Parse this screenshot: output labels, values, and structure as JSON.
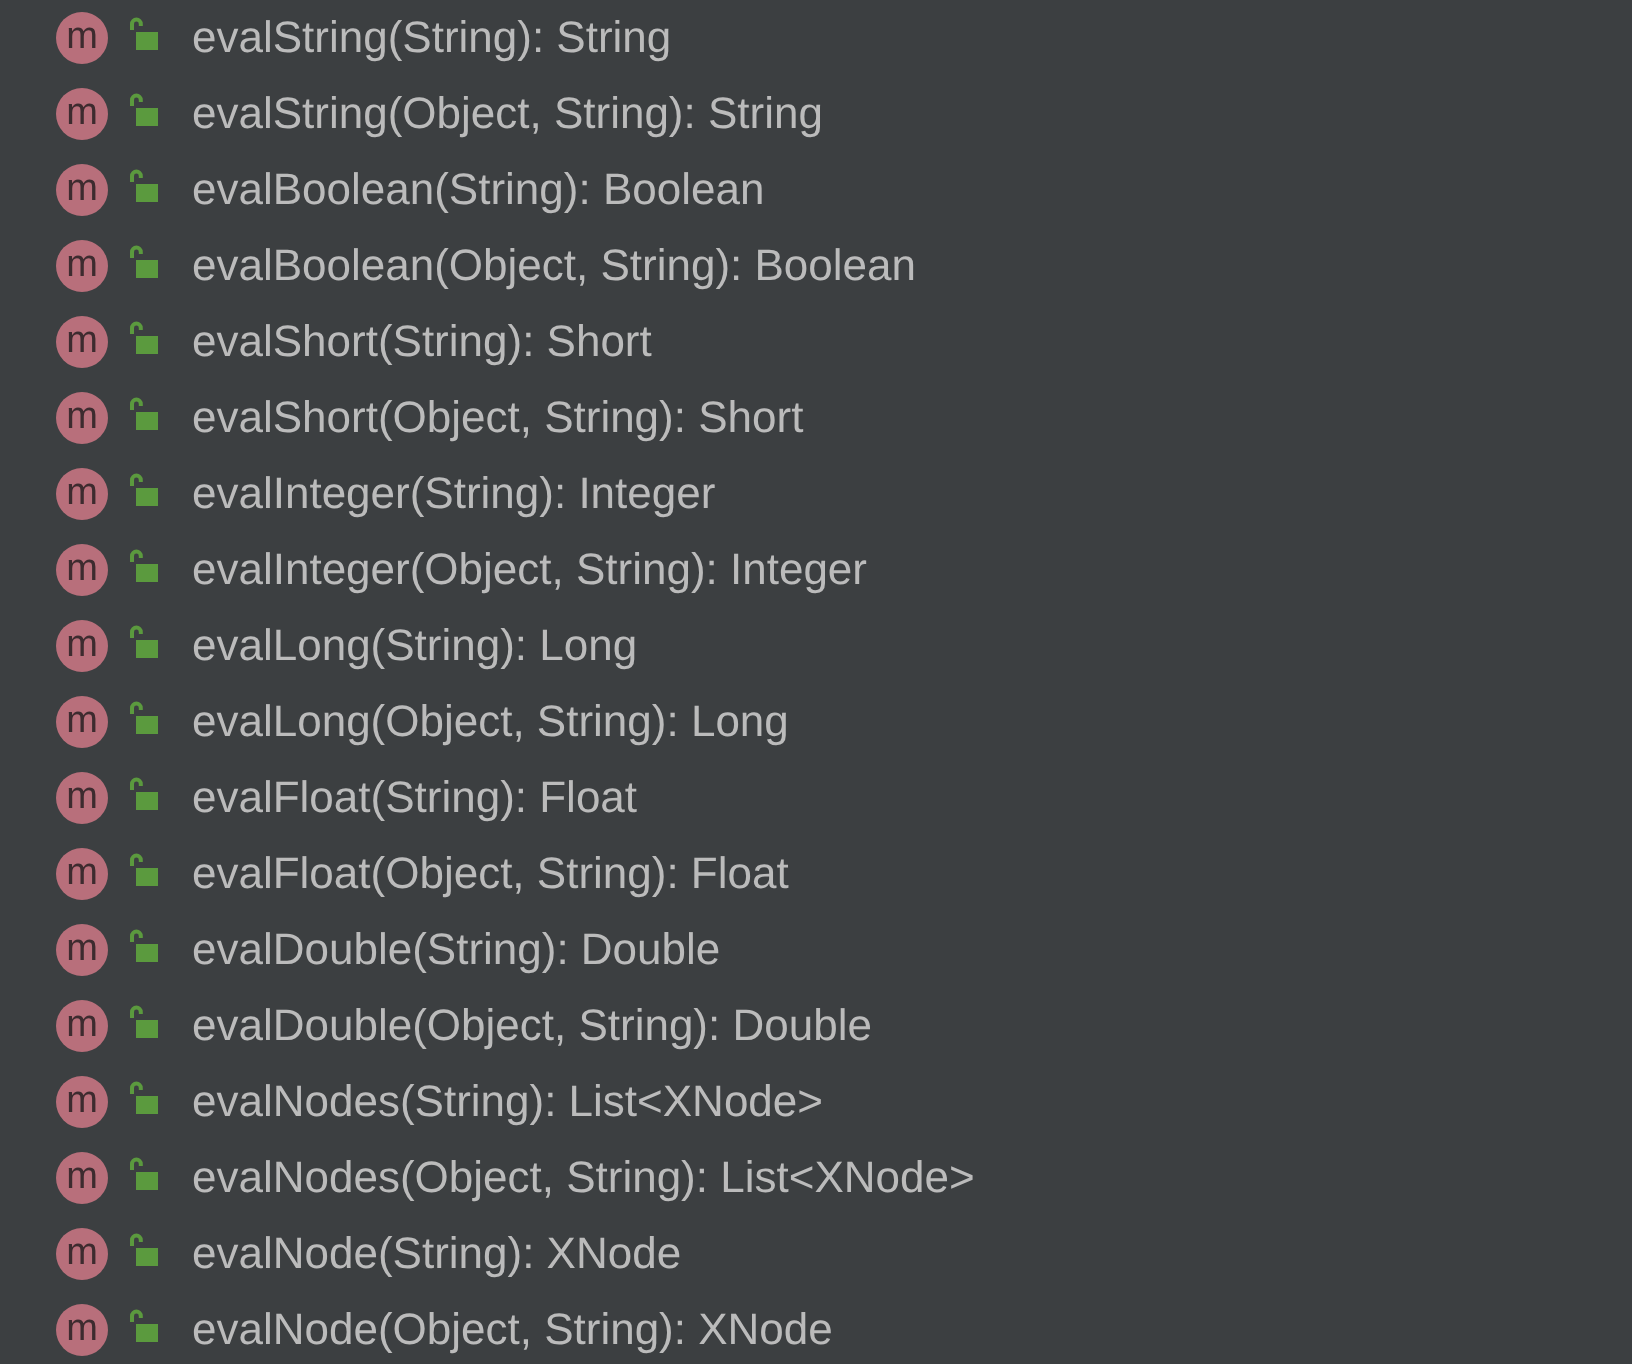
{
  "members": [
    {
      "icon_letter": "m",
      "signature": "evalString(String): String"
    },
    {
      "icon_letter": "m",
      "signature": "evalString(Object, String): String"
    },
    {
      "icon_letter": "m",
      "signature": "evalBoolean(String): Boolean"
    },
    {
      "icon_letter": "m",
      "signature": "evalBoolean(Object, String): Boolean"
    },
    {
      "icon_letter": "m",
      "signature": "evalShort(String): Short"
    },
    {
      "icon_letter": "m",
      "signature": "evalShort(Object, String): Short"
    },
    {
      "icon_letter": "m",
      "signature": "evalInteger(String): Integer"
    },
    {
      "icon_letter": "m",
      "signature": "evalInteger(Object, String): Integer"
    },
    {
      "icon_letter": "m",
      "signature": "evalLong(String): Long"
    },
    {
      "icon_letter": "m",
      "signature": "evalLong(Object, String): Long"
    },
    {
      "icon_letter": "m",
      "signature": "evalFloat(String): Float"
    },
    {
      "icon_letter": "m",
      "signature": "evalFloat(Object, String): Float"
    },
    {
      "icon_letter": "m",
      "signature": "evalDouble(String): Double"
    },
    {
      "icon_letter": "m",
      "signature": "evalDouble(Object, String): Double"
    },
    {
      "icon_letter": "m",
      "signature": "evalNodes(String): List<XNode>"
    },
    {
      "icon_letter": "m",
      "signature": "evalNodes(Object, String): List<XNode>"
    },
    {
      "icon_letter": "m",
      "signature": "evalNode(String): XNode"
    },
    {
      "icon_letter": "m",
      "signature": "evalNode(Object, String): XNode"
    }
  ]
}
